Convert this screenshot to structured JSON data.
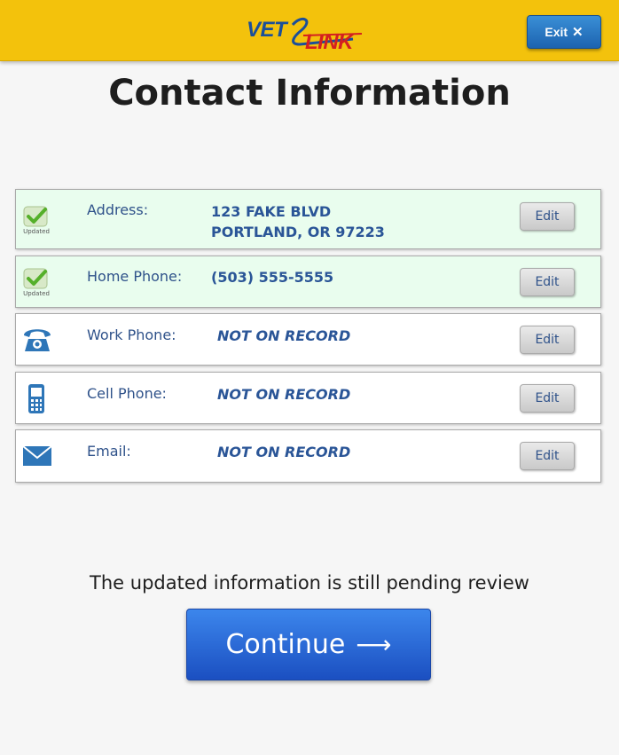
{
  "header": {
    "logo": {
      "part1": "VET",
      "part2": "LINK"
    },
    "exit_label": "Exit",
    "exit_icon": "close-icon"
  },
  "page": {
    "title": "Contact Information"
  },
  "rows": [
    {
      "label": "Address:",
      "value_line1": "123 FAKE BLVD",
      "value_line2": "PORTLAND, OR 97223",
      "status_icon": "updated-check-icon",
      "status_text": "Updated",
      "edit_label": "Edit"
    },
    {
      "label": "Home Phone:",
      "value_line1": "(503) 555-5555",
      "status_icon": "updated-check-icon",
      "status_text": "Updated",
      "edit_label": "Edit"
    },
    {
      "label": "Work Phone:",
      "value_line1": "NOT ON RECORD",
      "icon": "telephone-icon",
      "edit_label": "Edit"
    },
    {
      "label": "Cell Phone:",
      "value_line1": "NOT ON RECORD",
      "icon": "cell-phone-icon",
      "edit_label": "Edit"
    },
    {
      "label": "Email:",
      "value_line1": "NOT ON RECORD",
      "icon": "envelope-icon",
      "edit_label": "Edit"
    }
  ],
  "footer": {
    "pending_message": "The updated information is still pending review",
    "continue_label": "Continue",
    "continue_icon": "arrow-right-icon"
  },
  "colors": {
    "header_bg": "#f3c20c",
    "label_blue": "#2f528a",
    "value_blue": "#2a5597",
    "updated_row_bg": "#e9fdee",
    "primary_button": "#2a6ad8"
  }
}
